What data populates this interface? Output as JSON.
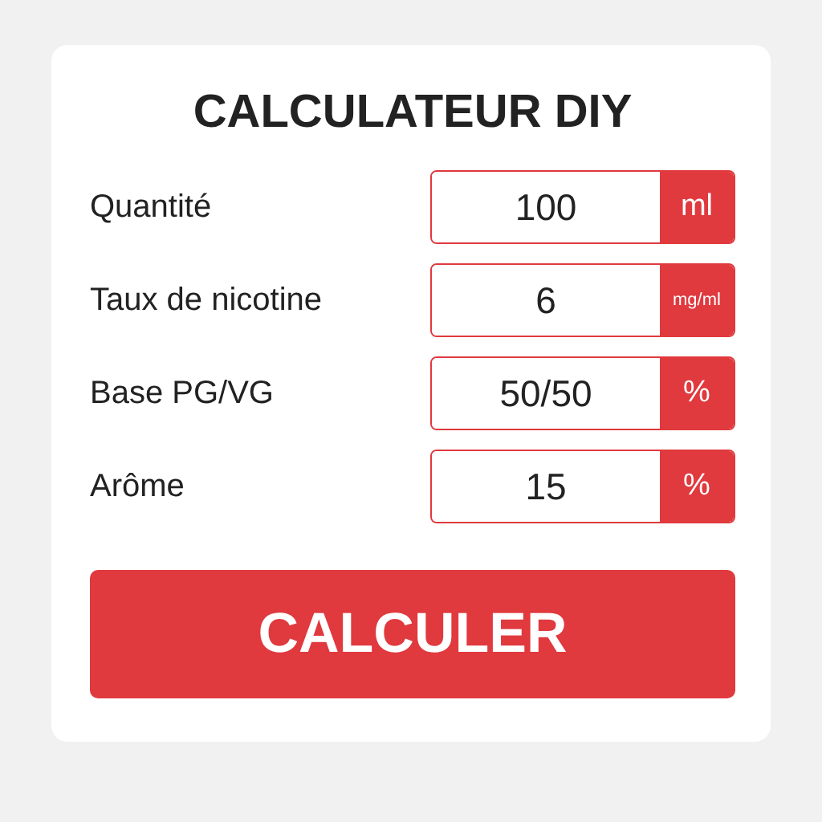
{
  "title": "CALCULATEUR DIY",
  "fields": [
    {
      "label": "Quantité",
      "value": "100",
      "unit": "ml"
    },
    {
      "label": "Taux de nicotine",
      "value": "6",
      "unit": "mg/ml"
    },
    {
      "label": "Base PG/VG",
      "value": "50/50",
      "unit": "%"
    },
    {
      "label": "Arôme",
      "value": "15",
      "unit": "%"
    }
  ],
  "button": "CALCULER"
}
